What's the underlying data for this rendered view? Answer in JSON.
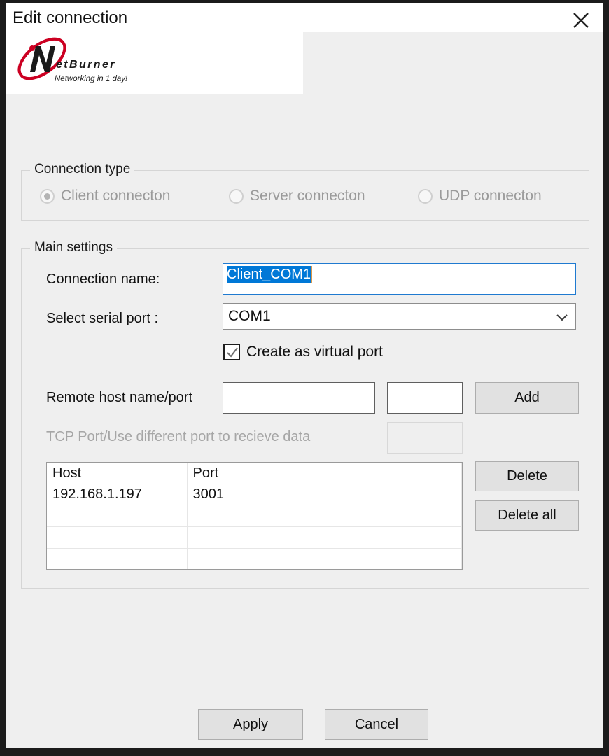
{
  "window": {
    "title": "Edit connection",
    "close_icon": "close-icon"
  },
  "logo": {
    "brand_mark": "N",
    "brand_name": "etBurner",
    "tagline": "Networking in 1 day!",
    "brand_color": "#cc0022"
  },
  "connection_type": {
    "group_label": "Connection type",
    "options": [
      {
        "label": "Client connecton",
        "selected": true,
        "disabled": true
      },
      {
        "label": "Server connecton",
        "selected": false,
        "disabled": true
      },
      {
        "label": "UDP connecton",
        "selected": false,
        "disabled": true
      }
    ]
  },
  "main_settings": {
    "group_label": "Main settings",
    "connection_name": {
      "label": "Connection name:",
      "value": "Client_COM1",
      "selected": true,
      "placeholder": ""
    },
    "serial_port": {
      "label": "Select serial port :",
      "value": "COM1",
      "arrow_icon": "chevron-down-icon"
    },
    "virtual_port": {
      "label": "Create as virtual port",
      "checked": true,
      "check_icon": "checkmark-icon"
    },
    "remote_host": {
      "label": "Remote host name/port",
      "host_value": "",
      "host_placeholder": "",
      "port_value": "",
      "port_placeholder": "",
      "add_label": "Add"
    },
    "tcp_port": {
      "label": "TCP Port/Use different port to recieve data",
      "value": "",
      "disabled": true
    },
    "table": {
      "columns": [
        "Host",
        "Port"
      ],
      "rows": [
        [
          "192.168.1.197",
          "3001"
        ],
        [
          "",
          ""
        ],
        [
          "",
          ""
        ],
        [
          "",
          ""
        ]
      ]
    },
    "delete_label": "Delete",
    "delete_all_label": "Delete all"
  },
  "footer": {
    "apply_label": "Apply",
    "cancel_label": "Cancel"
  },
  "colors": {
    "accent_selection": "#0078d7",
    "dialog_background": "#efefef",
    "button_face": "#e1e1e1"
  }
}
